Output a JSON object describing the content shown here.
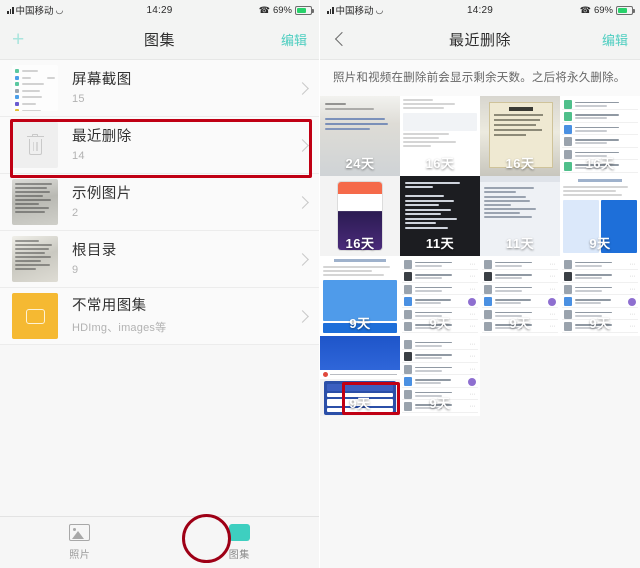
{
  "status_bar": {
    "carrier": "中国移动",
    "time": "14:29",
    "battery_percent": "69%",
    "signal_icon": "signal-bars-icon",
    "wifi_icon": "wifi-icon",
    "call_icon": "call-forwarding-icon",
    "battery_icon": "battery-charging-icon",
    "battery_fill": "#27d16a"
  },
  "left_screen": {
    "nav": {
      "add_label": "+",
      "title": "图集",
      "edit_label": "编辑",
      "edit_color": "#4ecec0"
    },
    "albums": [
      {
        "title": "屏幕截图",
        "count": "15",
        "thumb": "screenshot-list-thumbnail",
        "highlighted": false
      },
      {
        "title": "最近删除",
        "count": "14",
        "thumb": "trash-icon",
        "highlighted": true
      },
      {
        "title": "示例图片",
        "count": "2",
        "thumb": "document-photo-thumbnail",
        "highlighted": false
      },
      {
        "title": "根目录",
        "count": "9",
        "thumb": "document-photo-thumbnail",
        "highlighted": false
      },
      {
        "title": "不常用图集",
        "count": "HDImg、images等",
        "thumb": "folder-placeholder-thumbnail",
        "highlighted": false
      }
    ],
    "tabs": [
      {
        "label": "照片",
        "icon": "photo-icon",
        "active": false
      },
      {
        "label": "图集",
        "icon": "album-icon",
        "active": true
      }
    ],
    "annotations": {
      "recently_deleted_box_color": "#c00014",
      "album_tab_circle_color": "#9e0016"
    }
  },
  "right_screen": {
    "nav": {
      "back_icon": "back-chevron-icon",
      "title": "最近删除",
      "edit_label": "编辑",
      "edit_color": "#4ecec0"
    },
    "description": "照片和视频在删除前会显示剩余天数。之后将永久删除。",
    "grid_items": [
      {
        "days": "24天",
        "art": "a1",
        "kind": "photo",
        "highlighted": false
      },
      {
        "days": "16天",
        "art": "a2",
        "kind": "webform",
        "highlighted": false
      },
      {
        "days": "16天",
        "art": "a3",
        "kind": "poster",
        "highlighted": false
      },
      {
        "days": "16天",
        "art": "a4",
        "kind": "doclist",
        "highlighted": false
      },
      {
        "days": "16天",
        "art": "a5",
        "kind": "phone",
        "highlighted": false
      },
      {
        "days": "11天",
        "art": "a6",
        "kind": "textdark",
        "highlighted": false
      },
      {
        "days": "11天",
        "art": "a7",
        "kind": "chat",
        "highlighted": false
      },
      {
        "days": "9天",
        "art": "a8",
        "kind": "webshot",
        "highlighted": false
      },
      {
        "days": "9天",
        "art": "a9",
        "kind": "webshot",
        "highlighted": false
      },
      {
        "days": "9天",
        "art": "a10",
        "kind": "doclist",
        "highlighted": false
      },
      {
        "days": "9天",
        "art": "a10",
        "kind": "doclist",
        "highlighted": false
      },
      {
        "days": "9天",
        "art": "a10",
        "kind": "doclist",
        "highlighted": false
      },
      {
        "days": "9天",
        "art": "a11",
        "kind": "bluecard",
        "highlighted": true
      },
      {
        "days": "9天",
        "art": "a10",
        "kind": "doclist",
        "highlighted": false
      }
    ],
    "annotations": {
      "highlight_box_color": "#c00014"
    }
  }
}
